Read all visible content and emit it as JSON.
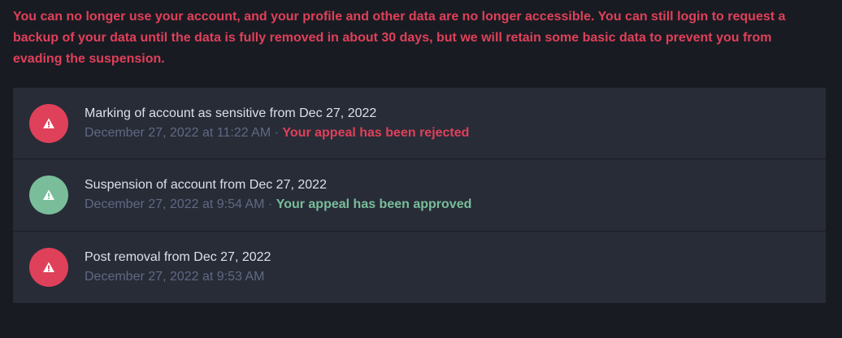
{
  "notice": {
    "text": "You can no longer use your account, and your profile and other data are no longer accessible. You can still login to request a backup of your data until the data is fully removed in about 30 days, but we will retain some basic data to prevent you from evading the suspension."
  },
  "strikes": [
    {
      "title": "Marking of account as sensitive from Dec 27, 2022",
      "date": "December 27, 2022 at 11:22 AM",
      "separator": "·",
      "status": "Your appeal has been rejected",
      "icon": "warning-icon",
      "badge_color": "#df405a",
      "status_color": "#df405a"
    },
    {
      "title": "Suspension of account from Dec 27, 2022",
      "date": "December 27, 2022 at 9:54 AM",
      "separator": "·",
      "status": "Your appeal has been approved",
      "icon": "warning-icon",
      "badge_color": "#79bd9a",
      "status_color": "#79bd9a"
    },
    {
      "title": "Post removal from Dec 27, 2022",
      "date": "December 27, 2022 at 9:53 AM",
      "icon": "warning-icon",
      "badge_color": "#df405a"
    }
  ],
  "colors": {
    "background": "#191b22",
    "panel": "#282c37",
    "danger": "#df405a",
    "success": "#79bd9a",
    "primary_text": "#d9e1e8",
    "muted_text": "#606984"
  }
}
